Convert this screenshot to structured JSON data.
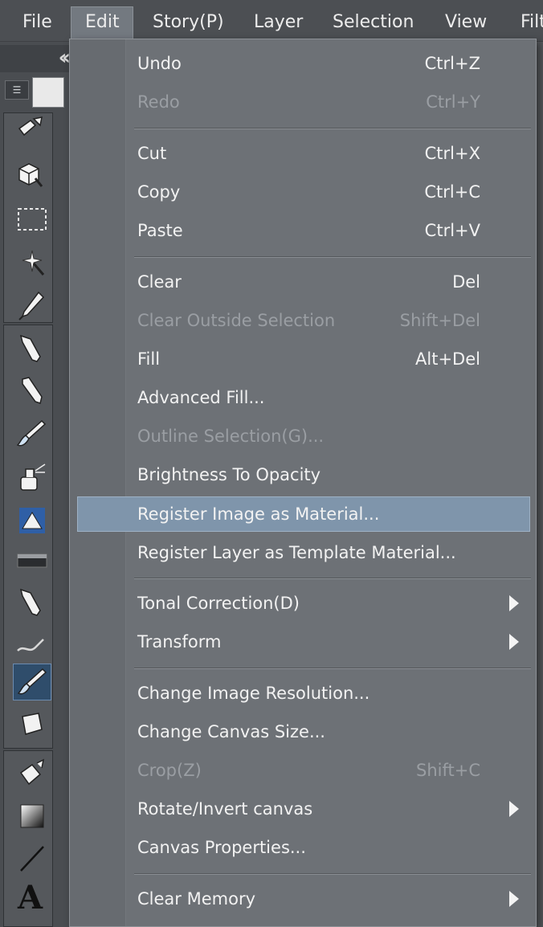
{
  "menubar": {
    "items": [
      {
        "label": "File"
      },
      {
        "label": "Edit"
      },
      {
        "label": "Story(P)"
      },
      {
        "label": "Layer"
      },
      {
        "label": "Selection"
      },
      {
        "label": "View"
      },
      {
        "label": "Filt"
      }
    ]
  },
  "toolbar": {
    "tools": [
      {
        "icon": "operation-icon"
      },
      {
        "icon": "move-layer-icon"
      },
      {
        "icon": "selection-marquee-icon"
      },
      {
        "icon": "auto-select-wand-icon"
      },
      {
        "icon": "eyedropper-icon"
      },
      {
        "icon": "pen-icon"
      },
      {
        "icon": "pencil-icon"
      },
      {
        "icon": "brush-icon"
      },
      {
        "icon": "airbrush-icon"
      },
      {
        "icon": "decoration-icon"
      },
      {
        "icon": "ruler-icon"
      },
      {
        "icon": "ink-pen-icon"
      },
      {
        "icon": "blend-icon"
      },
      {
        "icon": "brush-tool-icon"
      },
      {
        "icon": "eraser-icon"
      },
      {
        "icon": "fill-bucket-icon"
      },
      {
        "icon": "gradient-icon"
      },
      {
        "icon": "line-icon"
      },
      {
        "icon": "text-icon"
      }
    ],
    "text_tool_glyph": "A"
  },
  "edit_menu": {
    "items": [
      {
        "label": "Undo",
        "shortcut": "Ctrl+Z"
      },
      {
        "label": "Redo",
        "shortcut": "Ctrl+Y"
      },
      {
        "label": "Cut",
        "shortcut": "Ctrl+X"
      },
      {
        "label": "Copy",
        "shortcut": "Ctrl+C"
      },
      {
        "label": "Paste",
        "shortcut": "Ctrl+V"
      },
      {
        "label": "Clear",
        "shortcut": "Del"
      },
      {
        "label": "Clear Outside Selection",
        "shortcut": "Shift+Del"
      },
      {
        "label": "Fill",
        "shortcut": "Alt+Del"
      },
      {
        "label": "Advanced Fill...",
        "shortcut": ""
      },
      {
        "label": "Outline Selection(G)...",
        "shortcut": ""
      },
      {
        "label": "Brightness To Opacity",
        "shortcut": ""
      },
      {
        "label": "Register Image as Material...",
        "shortcut": ""
      },
      {
        "label": "Register Layer as Template Material...",
        "shortcut": ""
      },
      {
        "label": "Tonal Correction(D)",
        "shortcut": ""
      },
      {
        "label": "Transform",
        "shortcut": ""
      },
      {
        "label": "Change Image Resolution...",
        "shortcut": ""
      },
      {
        "label": "Change Canvas Size...",
        "shortcut": ""
      },
      {
        "label": "Crop(Z)",
        "shortcut": "Shift+C"
      },
      {
        "label": "Rotate/Invert canvas",
        "shortcut": ""
      },
      {
        "label": "Canvas Properties...",
        "shortcut": ""
      },
      {
        "label": "Clear Memory",
        "shortcut": ""
      }
    ]
  },
  "colors": {
    "menu_bg": "#6d7176",
    "highlight": "#7f95ab",
    "text": "#f2f2f2",
    "disabled_text": "#9a9ea3"
  }
}
